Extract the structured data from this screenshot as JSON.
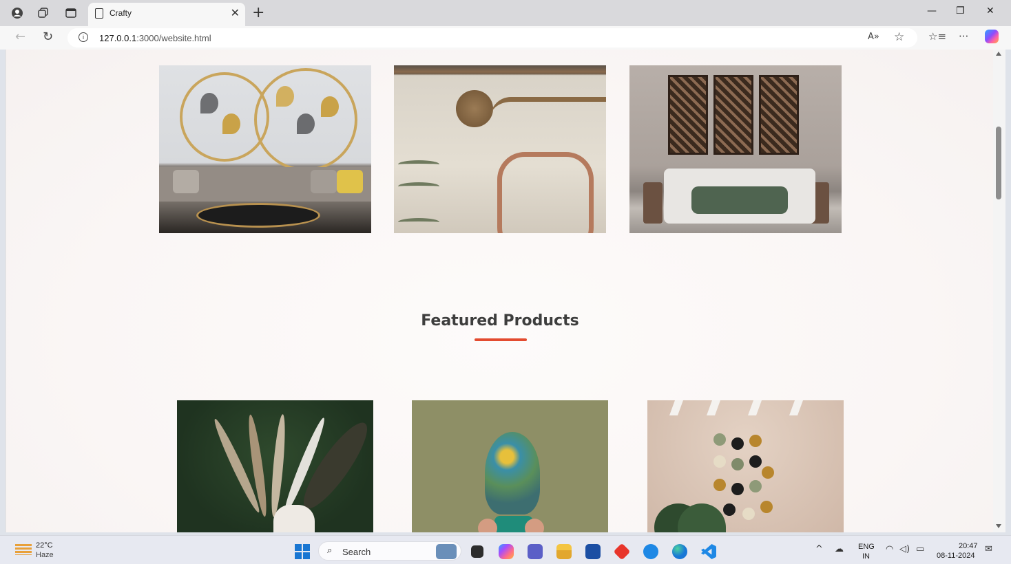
{
  "browser": {
    "tab_title": "Crafty",
    "url_host": "127.0.0.1",
    "url_path": ":3000/website.html"
  },
  "page": {
    "section_heading": "Featured Products",
    "accent_color": "#e34b2f"
  },
  "taskbar": {
    "temperature": "22°C",
    "weather": "Haze",
    "search_label": "Search",
    "lang_top": "ENG",
    "lang_bottom": "IN",
    "time": "20:47",
    "date": "08-11-2024"
  }
}
